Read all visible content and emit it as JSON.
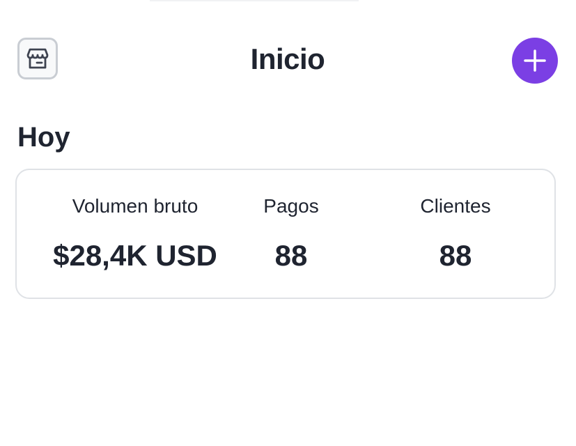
{
  "header": {
    "title": "Inicio",
    "left_icon": "store-icon",
    "right_icon": "plus-icon",
    "accent_color": "#7b3fe4"
  },
  "today": {
    "section_title": "Hoy",
    "stats": [
      {
        "label": "Volumen bruto",
        "value": "$28,4K USD"
      },
      {
        "label": "Pagos",
        "value": "88"
      },
      {
        "label": "Clientes",
        "value": "88"
      }
    ]
  }
}
